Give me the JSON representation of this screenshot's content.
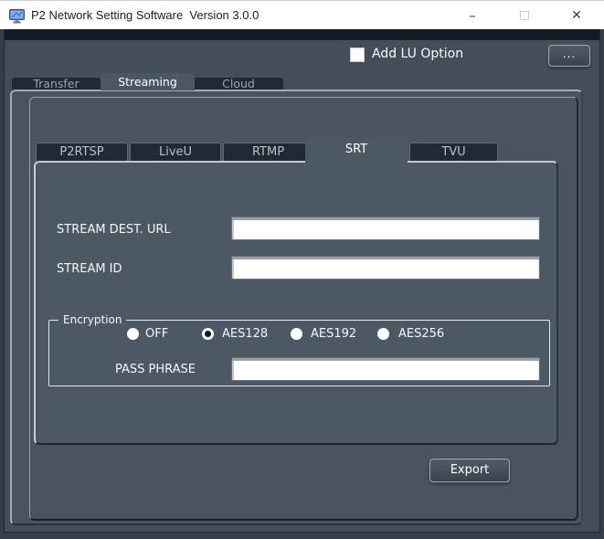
{
  "window": {
    "title": "P2 Network Setting Software  Version 3.0.0",
    "controls": {
      "minimize": "–",
      "maximize": "",
      "close": "✕"
    }
  },
  "header": {
    "add_lu_option": {
      "label": "Add LU Option",
      "checked": false
    },
    "more_button_label": "..."
  },
  "main_tabs": [
    {
      "label": "Transfer",
      "active": false
    },
    {
      "label": "Streaming",
      "active": true
    },
    {
      "label": "Cloud",
      "active": false
    }
  ],
  "sub_tabs": [
    {
      "label": "P2RTSP",
      "active": false
    },
    {
      "label": "LiveU",
      "active": false
    },
    {
      "label": "RTMP",
      "active": false
    },
    {
      "label": "SRT",
      "active": true
    },
    {
      "label": "TVU",
      "active": false
    }
  ],
  "srt_form": {
    "stream_dest_url": {
      "label": "STREAM DEST. URL",
      "value": ""
    },
    "stream_id": {
      "label": "STREAM ID",
      "value": ""
    },
    "encryption": {
      "group_label": "Encryption",
      "options": [
        {
          "label": "OFF",
          "selected": false
        },
        {
          "label": "AES128",
          "selected": true
        },
        {
          "label": "AES192",
          "selected": false
        },
        {
          "label": "AES256",
          "selected": false
        }
      ],
      "pass_phrase": {
        "label": "PASS PHRASE",
        "value": ""
      }
    }
  },
  "actions": {
    "export_label": "Export"
  },
  "colors": {
    "titlebar_bg": "#FFFFFF",
    "title_text": "#1D1D1D",
    "dark_strip": "#141B25",
    "window_bg": "#434E5A",
    "panel_bg": "#49545F",
    "subpanel_bg": "#4C5864",
    "tab_inactive_bg": "#202A35",
    "tab_inactive_text": "#9AA4AE",
    "active_text": "#FFFFFF",
    "border_light": "#A3ABB3",
    "groupbox_border": "#E3E6EA",
    "input_bg": "#FFFFFF",
    "button_face": "#3F4A56",
    "button_border": "#A2AAB2"
  }
}
